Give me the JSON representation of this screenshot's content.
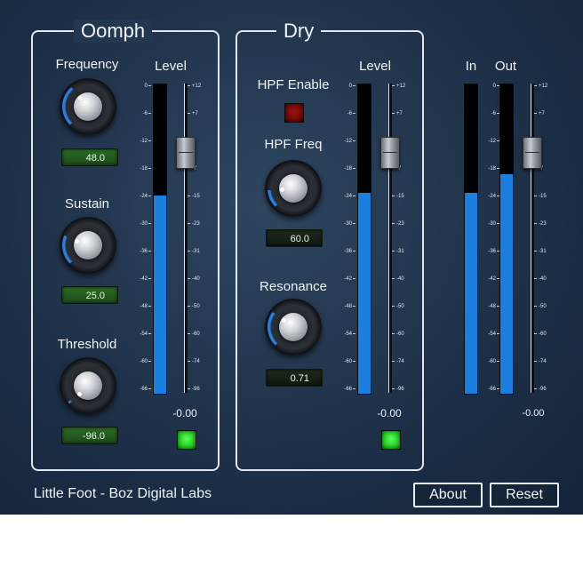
{
  "oomph": {
    "title": "Oomph",
    "frequency": {
      "label": "Frequency",
      "value": "48.0",
      "knob_fraction": 0.35
    },
    "sustain": {
      "label": "Sustain",
      "value": "25.0",
      "knob_fraction": 0.25
    },
    "threshold": {
      "label": "Threshold",
      "value": "-96.0",
      "knob_fraction": 0.0
    },
    "level_label": "Level",
    "meter_fill": 0.64,
    "fader_fraction": 0.22,
    "level_readout": "-0.00",
    "enabled_led": "on"
  },
  "dry": {
    "title": "Dry",
    "hpf_enable_label": "HPF Enable",
    "hpf_enable_led": "off",
    "hpf_freq": {
      "label": "HPF Freq",
      "value": "60.0",
      "knob_fraction": 0.15
    },
    "resonance": {
      "label": "Resonance",
      "value": "0.71",
      "knob_fraction": 0.3
    },
    "level_label": "Level",
    "meter_fill": 0.65,
    "fader_fraction": 0.22,
    "level_readout": "-0.00",
    "enabled_led": "on"
  },
  "io": {
    "in_label": "In",
    "out_label": "Out",
    "in_fill": 0.65,
    "out_fill": 0.71,
    "fader_fraction": 0.22,
    "out_readout": "-0.00"
  },
  "meter_scale": [
    "0",
    "-6",
    "-12",
    "-18",
    "-24",
    "-30",
    "-36",
    "-42",
    "-48",
    "-54",
    "-60",
    "-66"
  ],
  "fader_scale": [
    "+12",
    "+7",
    "0",
    "-7",
    "-15",
    "-23",
    "-31",
    "-40",
    "-50",
    "-60",
    "-74",
    "-96"
  ],
  "footer": {
    "text": "Little Foot - Boz Digital Labs"
  },
  "buttons": {
    "about": "About",
    "reset": "Reset"
  },
  "colors": {
    "meter_blue": "#1a7fe0",
    "led_green": "#18c418",
    "led_red": "#6d0808",
    "arc_blue": "#2a7de0"
  }
}
